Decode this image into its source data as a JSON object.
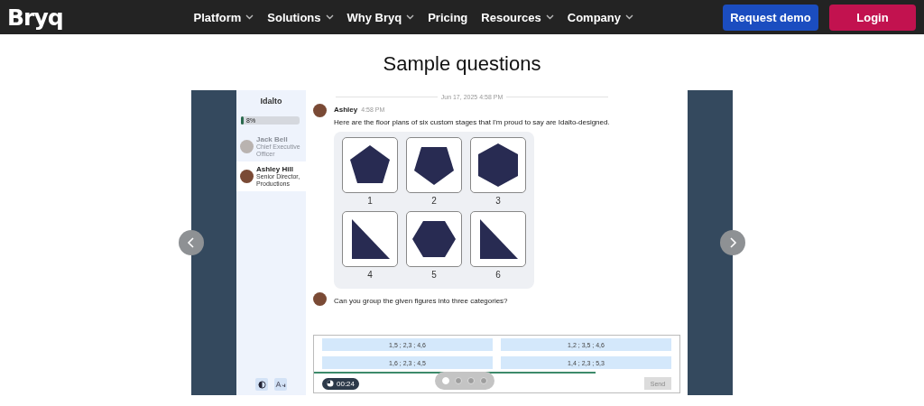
{
  "nav": {
    "logo": "Bryq",
    "menu": [
      {
        "label": "Platform",
        "dropdown": true
      },
      {
        "label": "Solutions",
        "dropdown": true
      },
      {
        "label": "Why Bryq",
        "dropdown": true
      },
      {
        "label": "Pricing",
        "dropdown": false
      },
      {
        "label": "Resources",
        "dropdown": true
      },
      {
        "label": "Company",
        "dropdown": true
      }
    ],
    "request_demo": "Request demo",
    "login": "Login"
  },
  "heading": "Sample questions",
  "slide": {
    "sidebar": {
      "title": "Idalto",
      "progress": {
        "level": 0.05,
        "reading": "8%"
      },
      "contacts": [
        {
          "name": "Jack Bell",
          "role": "Chief Executive Officer",
          "selected": false
        },
        {
          "name": "Ashley Hill",
          "role": "Senior Director, Productions",
          "selected": true
        }
      ]
    },
    "chat": {
      "date": "Jun 17, 2025 4:58 PM",
      "sender": "Ashley",
      "time": "4:58 PM",
      "message": "Here are the floor plans of six custom stages that I'm proud to say are Idalto-designed.",
      "figures": [
        {
          "kind": "pentagon",
          "label": "1"
        },
        {
          "kind": "pentagon-inverted",
          "label": "2"
        },
        {
          "kind": "hexagon-pointy",
          "label": "3"
        },
        {
          "kind": "triangle",
          "label": "4"
        },
        {
          "kind": "hexagon-flat",
          "label": "5"
        },
        {
          "kind": "triangle",
          "label": "6"
        }
      ],
      "question": "Can you group the given figures into three categories?"
    },
    "answers": [
      "1,5 ; 2,3 ; 4,6",
      "1,2 ; 3,5 ; 4,6",
      "1,6 ; 2,3 ; 4,5",
      "1,4 ; 2,3 ; 5,3"
    ],
    "timer": {
      "level": 0.77,
      "reading": "00:24"
    },
    "send": {
      "label": "Send",
      "disabled": true
    }
  },
  "carousel": {
    "dots": [
      {
        "selected": true
      },
      {
        "selected": false
      },
      {
        "selected": false
      },
      {
        "selected": false
      }
    ]
  }
}
